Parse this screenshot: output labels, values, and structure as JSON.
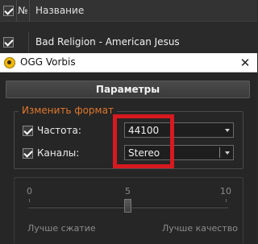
{
  "file_list": {
    "header": {
      "num_label": "№",
      "name_label": "Название"
    },
    "rows": [
      {
        "title": "Bad Religion - American Jesus",
        "checked": true
      }
    ]
  },
  "dialog": {
    "title": "OGG Vorbis",
    "close_glyph": "✕",
    "params_button": "Параметры",
    "format_group": {
      "legend": "Изменить формат",
      "frequency": {
        "label": "Частота:",
        "checked": true,
        "value": "44100"
      },
      "channels": {
        "label": "Каналы:",
        "checked": true,
        "value": "Stereo"
      }
    },
    "quality": {
      "ticks": [
        "0",
        "5",
        "10"
      ],
      "value": 5,
      "min_label": "Лучше сжатие",
      "max_label": "Лучше качество"
    }
  },
  "colors": {
    "legend": "#e0772a",
    "highlight": "#d71920",
    "app_icon": "#f0b90b"
  },
  "icons": {
    "app": "ogg-vorbis-icon",
    "close": "close-icon",
    "check": "checkmark-icon"
  }
}
